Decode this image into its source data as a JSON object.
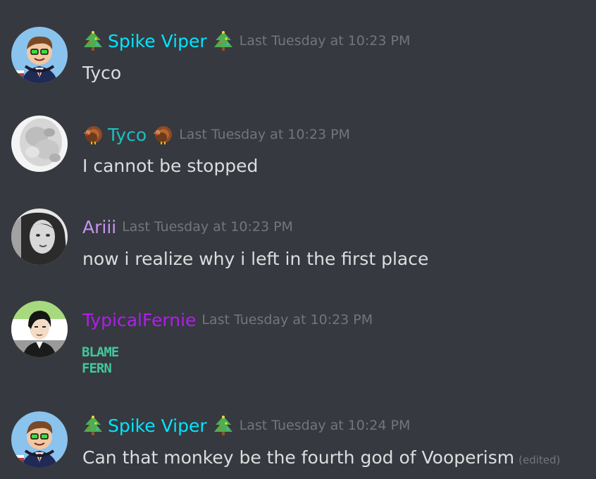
{
  "messages": [
    {
      "author": "Spike Viper",
      "author_color": "#00e5ff",
      "prefix_emoji": "christmas-tree",
      "suffix_emoji": "christmas-tree",
      "timestamp": "Last Tuesday at 10:23 PM",
      "content": "Tyco"
    },
    {
      "author": "Tyco",
      "author_color": "#1bc0c0",
      "prefix_emoji": "turkey",
      "suffix_emoji": "turkey",
      "timestamp": "Last Tuesday at 10:23 PM",
      "content": "I cannot be stopped"
    },
    {
      "author": "Ariii",
      "author_color": "#c694f0",
      "timestamp": "Last Tuesday at 10:23 PM",
      "content": "now i realize why i left in the first place"
    },
    {
      "author": "TypicalFernie",
      "author_color": "#b31cf0",
      "timestamp": "Last Tuesday at 10:23 PM",
      "emote_text_line1": "BLAME",
      "emote_text_line2": "FERN",
      "emote_color": "#41c79b"
    },
    {
      "author": "Spike Viper",
      "author_color": "#00e5ff",
      "prefix_emoji": "christmas-tree",
      "suffix_emoji": "christmas-tree",
      "timestamp": "Last Tuesday at 10:24 PM",
      "content": "Can that monkey be the fourth god of Vooperism",
      "edited_label": "(edited)"
    }
  ]
}
